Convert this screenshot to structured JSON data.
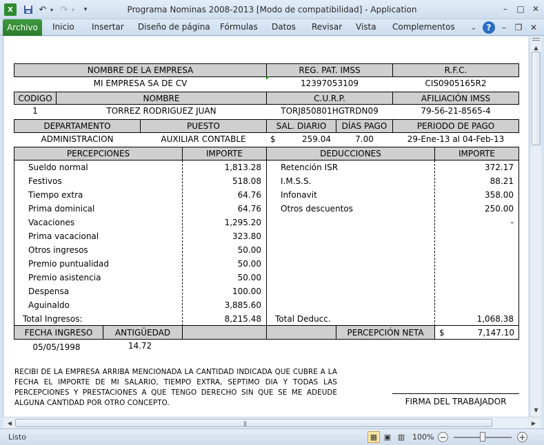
{
  "window": {
    "title": "Programa Nominas 2008-2013  [Modo de compatibilidad]  -  Application",
    "controls": {
      "minimize": "–",
      "maximize": "□",
      "close": "✕"
    }
  },
  "ribbon": {
    "file_tab": "Archivo",
    "tabs": [
      "Inicio",
      "Insertar",
      "Diseño de página",
      "Fórmulas",
      "Datos",
      "Revisar",
      "Vista",
      "Complementos"
    ],
    "help": "?"
  },
  "company": {
    "headers": {
      "name": "NOMBRE DE LA EMPRESA",
      "reg": "REG. PAT. IMSS",
      "rfc": "R.F.C."
    },
    "name": "MI EMPRESA SA DE CV",
    "reg": "12397053109",
    "rfc": "CIS0905165R2"
  },
  "employee": {
    "headers": {
      "code": "CODIGO",
      "name": "NOMBRE",
      "curp": "C.U.R.P.",
      "imss": "AFILIACIÓN IMSS"
    },
    "code": "1",
    "name": "TORREZ RODRIGUEZ JUAN",
    "curp": "TORJ850801HGTRDN09",
    "imss": "79-56-21-8565-4"
  },
  "job": {
    "headers": {
      "dept": "DEPARTAMENTO",
      "position": "PUESTO",
      "salary": "SAL. DIARIO",
      "days": "DÍAS PAGO",
      "period": "PERIODO DE PAGO"
    },
    "dept": "ADMINISTRACION",
    "position": "AUXILIAR CONTABLE",
    "currency": "$",
    "salary": "259.04",
    "days": "7.00",
    "period": "29-Ene-13 al 04-Feb-13"
  },
  "perceptions": {
    "header": "PERCEPCIONES",
    "amount_header": "IMPORTE",
    "rows": [
      {
        "label": "Sueldo normal",
        "amount": "1,813.28"
      },
      {
        "label": "Festivos",
        "amount": "518.08"
      },
      {
        "label": "Tiempo extra",
        "amount": "64.76"
      },
      {
        "label": "Prima dominical",
        "amount": "64.76"
      },
      {
        "label": "Vacaciones",
        "amount": "1,295.20"
      },
      {
        "label": "Prima vacacional",
        "amount": "323.80"
      },
      {
        "label": "Otros ingresos",
        "amount": "50.00"
      },
      {
        "label": "Premio puntualidad",
        "amount": "50.00"
      },
      {
        "label": "Premio asistencia",
        "amount": "50.00"
      },
      {
        "label": "Despensa",
        "amount": "100.00"
      },
      {
        "label": "Aguinaldo",
        "amount": "3,885.60"
      }
    ],
    "total_label": "Total Ingresos:",
    "total": "8,215.48"
  },
  "deductions": {
    "header": "DEDUCCIONES",
    "amount_header": "IMPORTE",
    "rows": [
      {
        "label": "Retención ISR",
        "amount": "372.17"
      },
      {
        "label": "I.M.S.S.",
        "amount": "88.21"
      },
      {
        "label": "Infonavit",
        "amount": "358.00"
      },
      {
        "label": "Otros descuentos",
        "amount": "250.00"
      },
      {
        "label": "",
        "amount": "-"
      }
    ],
    "total_label": "Total Deducc.",
    "total": "1,068.38"
  },
  "footer": {
    "start_header": "FECHA INGRESO",
    "seniority_header": "ANTIGÜEDAD",
    "net_header": "PERCEPCIÓN NETA",
    "start": "05/05/1998",
    "seniority": "14.72",
    "currency": "$",
    "net": "7,147.10"
  },
  "receipt_text": "RECIBI DE LA EMPRESA ARRIBA MENCIONADA LA CANTIDAD INDICADA QUE CUBRE A LA FECHA EL IMPORTE DE MI SALARIO, TIEMPO EXTRA, SEPTIMO DIA Y TODAS LAS PERCEPCIONES Y PRESTACIONES A QUE TENGO DERECHO SIN QUE SE ME ADEUDE ALGUNA CANTIDAD POR OTRO CONCEPTO.",
  "signature_label": "FIRMA DEL TRABAJADOR",
  "status": {
    "text": "Listo",
    "zoom": "100%"
  }
}
